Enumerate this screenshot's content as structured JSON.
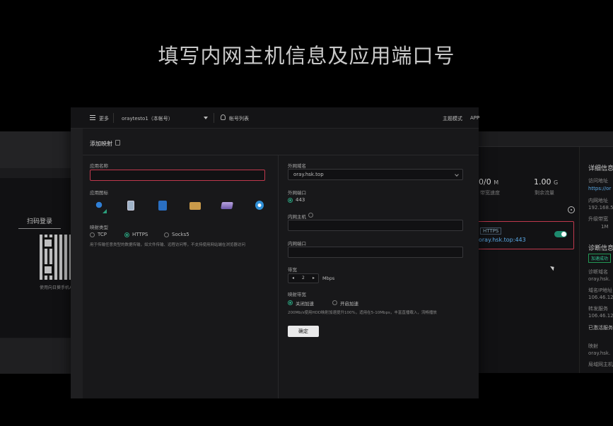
{
  "caption": "填写内网主机信息及应用端口号",
  "login_panel": {
    "scan_title": "扫码登录",
    "scan_hint": "使用向日葵手机APP"
  },
  "topbar": {
    "more": "更多",
    "account": "oraytesto1（本帐号）",
    "account_list": "帐号列表",
    "theme": "主题模式",
    "app": "APP"
  },
  "page": {
    "title": "添加映射"
  },
  "form_left": {
    "app_name_label": "应用名称",
    "app_name_value": "",
    "app_icon_label": "应用图标",
    "icons": [
      "ie-icon",
      "phone-icon",
      "book-icon",
      "folder-icon",
      "stack-icon",
      "webcam-icon"
    ],
    "map_type_label": "映射类型",
    "types": [
      {
        "label": "TCP",
        "selected": false
      },
      {
        "label": "HTTPS",
        "selected": true
      },
      {
        "label": "Socks5",
        "selected": false
      }
    ],
    "type_hint": "用于传输任意类型的数据传输，如文件传输、远程访问等，不支持使用网站端在浏览器访问"
  },
  "form_right": {
    "domain_label": "外网域名",
    "domain_value": "oray.hsk.top",
    "port_label": "外网端口",
    "port_option": "443",
    "host_label": "内网主机",
    "host_value": "",
    "inner_port_label": "内网端口",
    "inner_port_value": "",
    "bandwidth_label": "带宽",
    "bandwidth_value": "2",
    "bandwidth_unit": "Mbps",
    "accel_label": "映射带宽",
    "accel_options": [
      {
        "label": "关闭加速",
        "selected": true
      },
      {
        "label": "开启加速",
        "selected": false
      }
    ],
    "accel_hint": "200Mb/s使用HDD映射加速提升100%，适用在5-10Mbps，丰富直播载入，流畅播放",
    "submit_label": "确定"
  },
  "right_panel": {
    "stat1_value": "0/0",
    "stat1_unit": "M",
    "stat1_sub": "带宽速度",
    "stat2_value": "1.00",
    "stat2_unit": "G",
    "stat2_sub": "剩余流量",
    "card_tag": "HTTPS",
    "card_url": "oray.hsk.top:443",
    "detail_head": "详细信息",
    "detail_link": "https://or",
    "inner_addr_label": "内网地址",
    "inner_addr_value": "192.168.5",
    "upgrade_label": "升级带宽",
    "upgrade_value": "1M",
    "diag_head": "诊断信息",
    "diag_badge": "加速成功",
    "diag_lines": [
      "诊断域名",
      "oray.hsk.",
      "域名IP地址",
      "106.46.12",
      "转发服务",
      "106.46.12",
      "已激活服务"
    ],
    "bottom_lines": [
      "映射",
      "oray.hsk.",
      "局域网主机"
    ]
  },
  "colors": {
    "accent_green": "#2aa07d",
    "error_red": "#c0394d",
    "link_blue": "#5aa9e6"
  }
}
